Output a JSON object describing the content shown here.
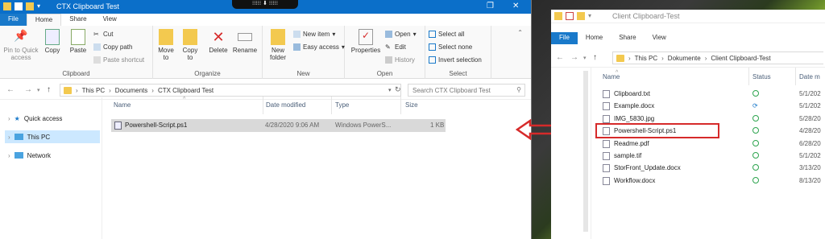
{
  "left": {
    "title": "CTX Clipboard Test",
    "tabs": [
      "File",
      "Home",
      "Share",
      "View"
    ],
    "ribbon": {
      "clipboard": {
        "pin": "Pin to Quick access",
        "copy": "Copy",
        "paste": "Paste",
        "cut": "Cut",
        "copy_path": "Copy path",
        "paste_shortcut": "Paste shortcut",
        "label": "Clipboard"
      },
      "organize": {
        "move_to": "Move to",
        "copy_to": "Copy to",
        "delete": "Delete",
        "rename": "Rename",
        "label": "Organize"
      },
      "new": {
        "new_folder": "New folder",
        "new_item": "New item",
        "easy_access": "Easy access",
        "label": "New"
      },
      "open": {
        "properties": "Properties",
        "open": "Open",
        "edit": "Edit",
        "history": "History",
        "label": "Open"
      },
      "select": {
        "all": "Select all",
        "none": "Select none",
        "invert": "Invert selection",
        "label": "Select"
      }
    },
    "address": {
      "parts": [
        "This PC",
        "Documents",
        "CTX Clipboard Test"
      ],
      "search_placeholder": "Search CTX Clipboard Test"
    },
    "nav": [
      "Quick access",
      "This PC",
      "Network"
    ],
    "columns": [
      "Name",
      "Date modified",
      "Type",
      "Size"
    ],
    "files": [
      {
        "name": "Powershell-Script.ps1",
        "date": "4/28/2020 9:06 AM",
        "type": "Windows PowerS...",
        "size": "1 KB"
      }
    ]
  },
  "right": {
    "title": "Client Clipboard-Test",
    "tabs": [
      "File",
      "Home",
      "Share",
      "View"
    ],
    "address": {
      "parts": [
        "This PC",
        "Dokumente",
        "Client Clipboard-Test"
      ]
    },
    "columns": [
      "Name",
      "Status",
      "Date m"
    ],
    "files": [
      {
        "name": "Clipboard.txt",
        "status": "ok",
        "date": "5/1/202"
      },
      {
        "name": "Example.docx",
        "status": "sync",
        "date": "5/1/202"
      },
      {
        "name": "IMG_5830.jpg",
        "status": "ok",
        "date": "5/28/20"
      },
      {
        "name": "Powershell-Script.ps1",
        "status": "ok",
        "date": "4/28/20"
      },
      {
        "name": "Readme.pdf",
        "status": "ok",
        "date": "6/28/20"
      },
      {
        "name": "sample.tif",
        "status": "ok",
        "date": "5/1/202"
      },
      {
        "name": "StorFront_Update.docx",
        "status": "ok",
        "date": "3/13/20"
      },
      {
        "name": "Workflow.docx",
        "status": "ok",
        "date": "8/13/20"
      }
    ]
  },
  "colors": {
    "accent": "#1979ca",
    "arrow": "#d62a2a"
  }
}
